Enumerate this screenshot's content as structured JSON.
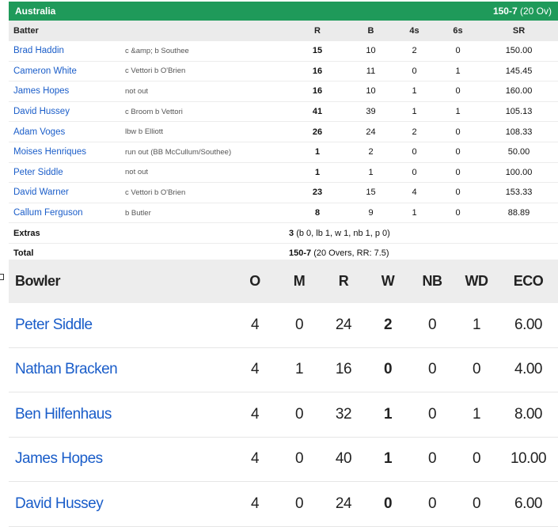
{
  "batting": {
    "team": "Australia",
    "score": "150-7",
    "overs": "(20 Ov)",
    "headers": [
      "Batter",
      "R",
      "B",
      "4s",
      "6s",
      "SR"
    ],
    "rows": [
      {
        "name": "Brad Haddin",
        "dismissal": "c &amp; b Southee",
        "r": "15",
        "b": "10",
        "fours": "2",
        "sixes": "0",
        "sr": "150.00"
      },
      {
        "name": "Cameron White",
        "dismissal": "c Vettori b O'Brien",
        "r": "16",
        "b": "11",
        "fours": "0",
        "sixes": "1",
        "sr": "145.45"
      },
      {
        "name": "James Hopes",
        "dismissal": "not out",
        "r": "16",
        "b": "10",
        "fours": "1",
        "sixes": "0",
        "sr": "160.00"
      },
      {
        "name": "David Hussey",
        "dismissal": "c Broom b Vettori",
        "r": "41",
        "b": "39",
        "fours": "1",
        "sixes": "1",
        "sr": "105.13"
      },
      {
        "name": "Adam Voges",
        "dismissal": "lbw b Elliott",
        "r": "26",
        "b": "24",
        "fours": "2",
        "sixes": "0",
        "sr": "108.33"
      },
      {
        "name": "Moises Henriques",
        "dismissal": "run out (BB McCullum/Southee)",
        "r": "1",
        "b": "2",
        "fours": "0",
        "sixes": "0",
        "sr": "50.00"
      },
      {
        "name": "Peter Siddle",
        "dismissal": "not out",
        "r": "1",
        "b": "1",
        "fours": "0",
        "sixes": "0",
        "sr": "100.00"
      },
      {
        "name": "David Warner",
        "dismissal": "c Vettori b O'Brien",
        "r": "23",
        "b": "15",
        "fours": "4",
        "sixes": "0",
        "sr": "153.33"
      },
      {
        "name": "Callum Ferguson",
        "dismissal": "b Butler",
        "r": "8",
        "b": "9",
        "fours": "1",
        "sixes": "0",
        "sr": "88.89"
      }
    ],
    "extras": {
      "label": "Extras",
      "value": "3",
      "detail": "(b 0, lb 1, w 1, nb 1, p 0)"
    },
    "total": {
      "label": "Total",
      "value": "150-7",
      "detail": "(20 Overs, RR: 7.5)"
    }
  },
  "bowling": {
    "headers": [
      "Bowler",
      "O",
      "M",
      "R",
      "W",
      "NB",
      "WD",
      "ECO"
    ],
    "rows": [
      {
        "name": "Peter Siddle",
        "o": "4",
        "m": "0",
        "r": "24",
        "w": "2",
        "nb": "0",
        "wd": "1",
        "eco": "6.00"
      },
      {
        "name": "Nathan Bracken",
        "o": "4",
        "m": "1",
        "r": "16",
        "w": "0",
        "nb": "0",
        "wd": "0",
        "eco": "4.00"
      },
      {
        "name": "Ben Hilfenhaus",
        "o": "4",
        "m": "0",
        "r": "32",
        "w": "1",
        "nb": "0",
        "wd": "1",
        "eco": "8.00"
      },
      {
        "name": "James Hopes",
        "o": "4",
        "m": "0",
        "r": "40",
        "w": "1",
        "nb": "0",
        "wd": "0",
        "eco": "10.00"
      },
      {
        "name": "David Hussey",
        "o": "4",
        "m": "0",
        "r": "24",
        "w": "0",
        "nb": "0",
        "wd": "0",
        "eco": "6.00"
      }
    ]
  },
  "colors": {
    "header_bar": "#1f9a5a",
    "link": "#1a5dc9"
  }
}
